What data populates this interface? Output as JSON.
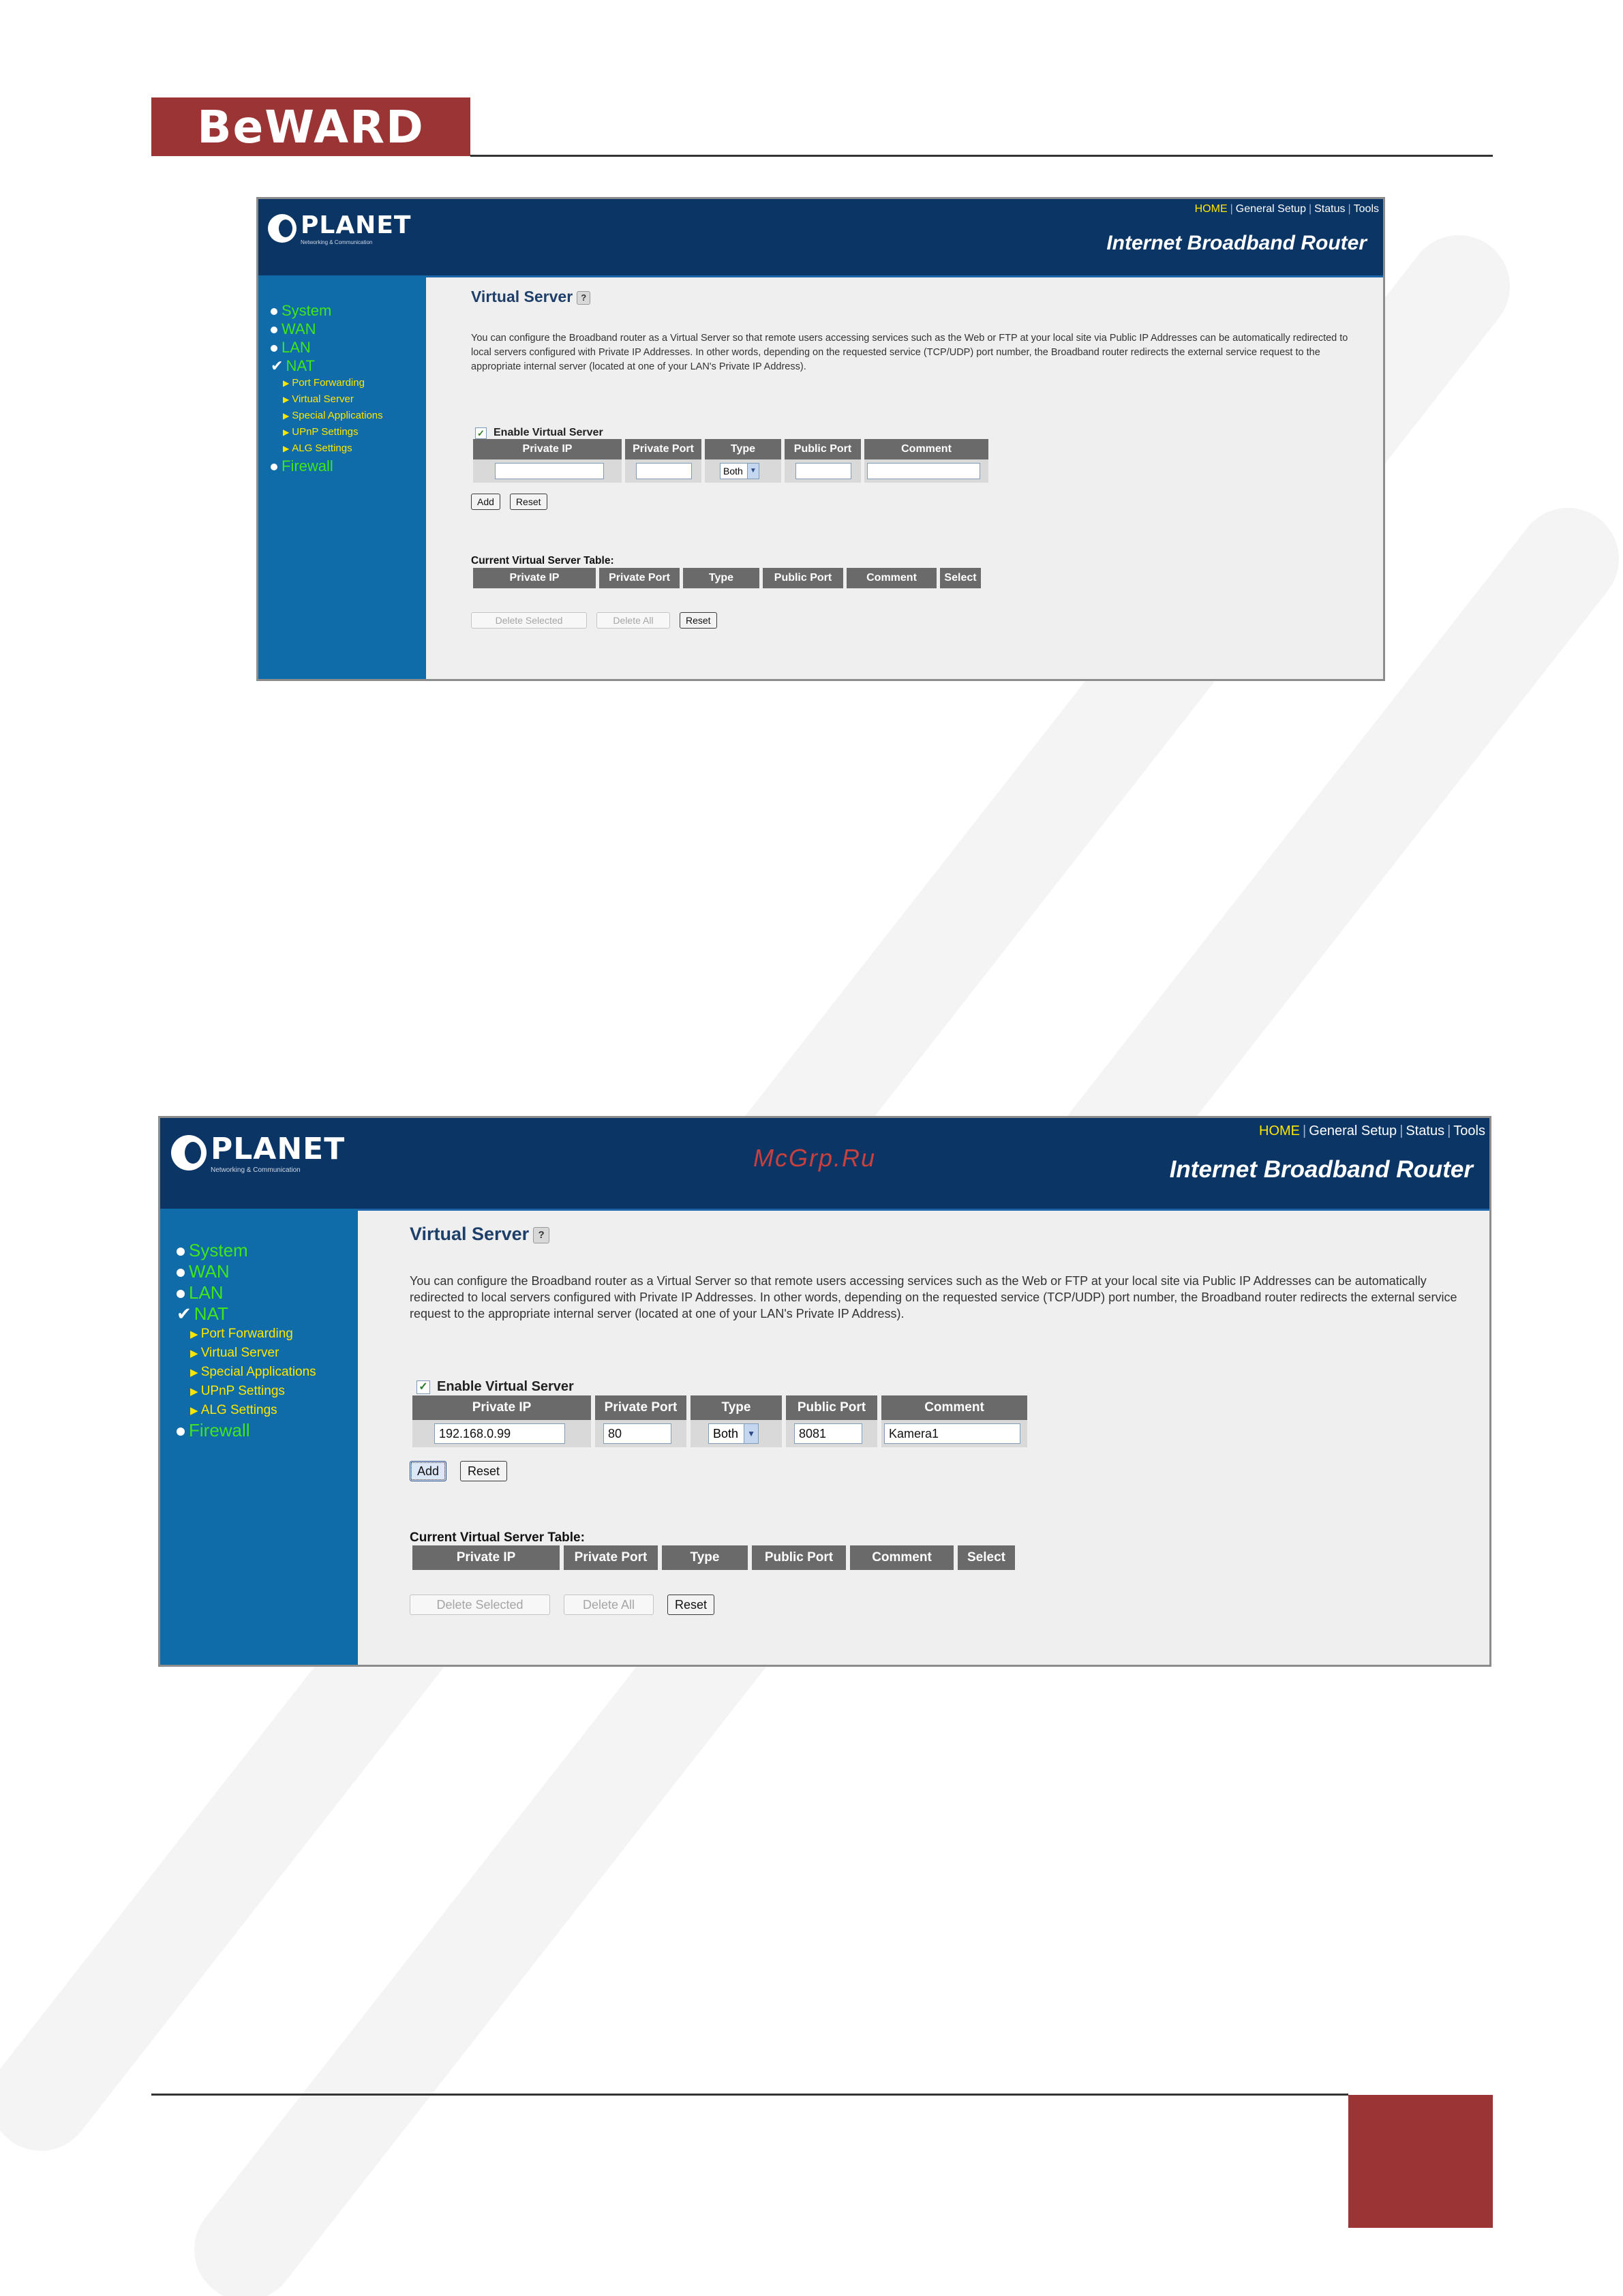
{
  "page": {
    "brand_logo": "BeWARD"
  },
  "screenshots": [
    {
      "header": {
        "brand": "PLANET",
        "brand_sub": "Networking & Communication",
        "nav": [
          "HOME",
          "General Setup",
          "Status",
          "Tools"
        ],
        "title": "Internet Broadband Router"
      },
      "sidebar": {
        "items": [
          {
            "label": "System"
          },
          {
            "label": "WAN"
          },
          {
            "label": "LAN"
          },
          {
            "label": "NAT"
          },
          {
            "label": "Port Forwarding"
          },
          {
            "label": "Virtual Server"
          },
          {
            "label": "Special Applications"
          },
          {
            "label": "UPnP Settings"
          },
          {
            "label": "ALG Settings"
          },
          {
            "label": "Firewall"
          }
        ]
      },
      "content": {
        "title": "Virtual Server",
        "description": "You can configure the Broadband router as a Virtual Server so that remote users accessing services such as the Web or FTP at your local site via Public IP Addresses can be automatically redirected to local servers configured with Private IP Addresses. In other words, depending on the requested service (TCP/UDP) port number, the Broadband router redirects the external service request to the appropriate internal server (located at one of your LAN's Private IP Address).",
        "enable_label": "Enable Virtual Server",
        "input_headers": [
          "Private IP",
          "Private Port",
          "Type",
          "Public Port",
          "Comment"
        ],
        "values": {
          "private_ip": "",
          "private_port": "",
          "type": "Both",
          "public_port": "",
          "comment": ""
        },
        "add_label": "Add",
        "reset_label": "Reset",
        "current_table_label": "Current Virtual Server Table:",
        "table_headers": [
          "Private IP",
          "Private Port",
          "Type",
          "Public Port",
          "Comment",
          "Select"
        ],
        "delete_selected_label": "Delete Selected",
        "delete_all_label": "Delete All",
        "table_reset_label": "Reset"
      }
    },
    {
      "header": {
        "brand": "PLANET",
        "brand_sub": "Networking & Communication",
        "nav": [
          "HOME",
          "General Setup",
          "Status",
          "Tools"
        ],
        "title": "Internet Broadband Router",
        "watermark": "McGrp.Ru"
      },
      "sidebar": {
        "items": [
          {
            "label": "System"
          },
          {
            "label": "WAN"
          },
          {
            "label": "LAN"
          },
          {
            "label": "NAT"
          },
          {
            "label": "Port Forwarding"
          },
          {
            "label": "Virtual Server"
          },
          {
            "label": "Special Applications"
          },
          {
            "label": "UPnP Settings"
          },
          {
            "label": "ALG Settings"
          },
          {
            "label": "Firewall"
          }
        ]
      },
      "content": {
        "title": "Virtual Server",
        "description": "You can configure the Broadband router as a Virtual Server so that remote users accessing services such as the Web or FTP at your local site via Public IP Addresses can be automatically redirected to local servers configured with Private IP Addresses. In other words, depending on the requested service (TCP/UDP) port number, the Broadband router redirects the external service request to the appropriate internal server (located at one of your LAN's Private IP Address).",
        "enable_label": "Enable Virtual Server",
        "input_headers": [
          "Private IP",
          "Private Port",
          "Type",
          "Public Port",
          "Comment"
        ],
        "values": {
          "private_ip": "192.168.0.99",
          "private_port": "80",
          "type": "Both",
          "public_port": "8081",
          "comment": "Kamera1"
        },
        "add_label": "Add",
        "reset_label": "Reset",
        "current_table_label": "Current Virtual Server Table:",
        "table_headers": [
          "Private IP",
          "Private Port",
          "Type",
          "Public Port",
          "Comment",
          "Select"
        ],
        "delete_selected_label": "Delete Selected",
        "delete_all_label": "Delete All",
        "table_reset_label": "Reset"
      }
    }
  ],
  "colors": {
    "brand_red": "#9a3435",
    "router_header": "#0b3565",
    "router_sidebar": "#0f6ca8",
    "menu_main": "#40e51c",
    "menu_sub": "#ffe600",
    "table_header": "#6a6a6a"
  }
}
